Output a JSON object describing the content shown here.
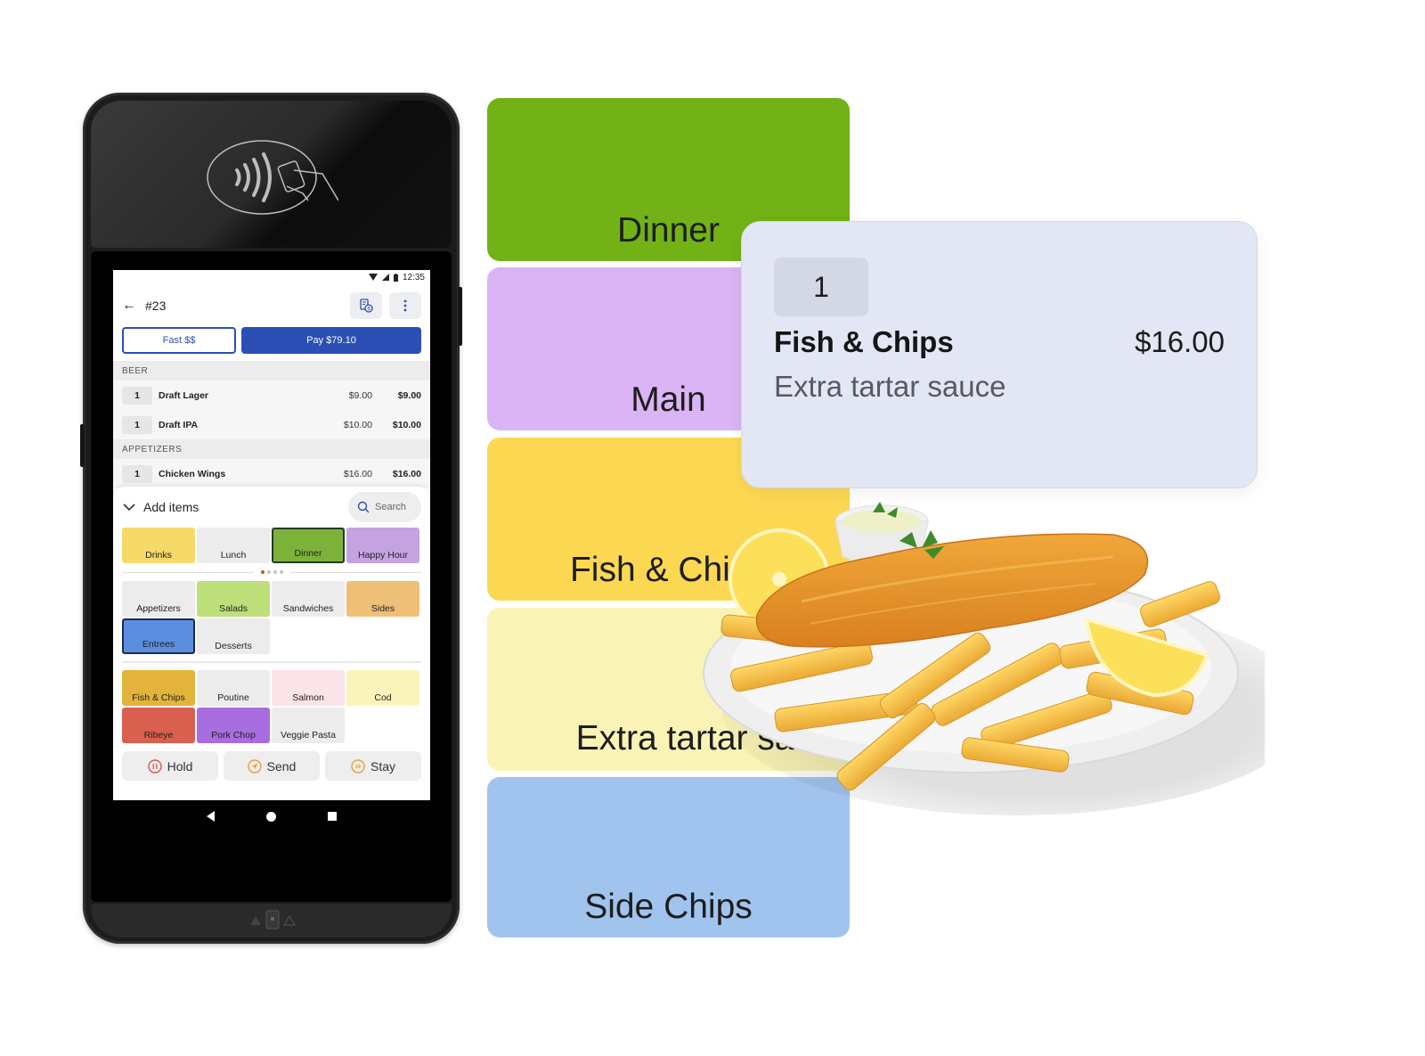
{
  "colors": {
    "accent_blue": "#2b4fb5",
    "dinner_green": "#72b216",
    "main_purple": "#dab4f4",
    "fish_yellow": "#fcd852",
    "tartar_lightyellow": "#faf3b6",
    "side_blue": "#a1c4ee",
    "detail_card_bg": "#e3e6f4"
  },
  "device": {
    "status_bar": {
      "time": "12:35"
    },
    "header": {
      "order_number": "#23",
      "back_icon": "arrow-left-icon",
      "receipt_icon": "receipt-dollar-icon",
      "more_icon": "more-vertical-icon"
    },
    "buttons": {
      "fast_label": "Fast $$",
      "pay_label": "Pay $79.10"
    },
    "order_sections": [
      {
        "title": "BEER",
        "items": [
          {
            "qty": "1",
            "name": "Draft Lager",
            "unit_price": "$9.00",
            "total": "$9.00"
          },
          {
            "qty": "1",
            "name": "Draft IPA",
            "unit_price": "$10.00",
            "total": "$10.00"
          }
        ]
      },
      {
        "title": "APPETIZERS",
        "items": [
          {
            "qty": "1",
            "name": "Chicken Wings",
            "unit_price": "$16.00",
            "total": "$16.00"
          }
        ]
      }
    ],
    "add_items": {
      "title": "Add items",
      "search_placeholder": "Search",
      "menus": [
        {
          "label": "Drinks",
          "color": "#f7d96a"
        },
        {
          "label": "Lunch",
          "color": "#ececec"
        },
        {
          "label": "Dinner",
          "color": "#7db23a",
          "selected": true
        },
        {
          "label": "Happy Hour",
          "color": "#c5a3e0"
        }
      ],
      "page_dots": {
        "count": 4,
        "active": 1
      },
      "categories": [
        {
          "label": "Appetizers",
          "color": "#ececec"
        },
        {
          "label": "Salads",
          "color": "#bde07a"
        },
        {
          "label": "Sandwiches",
          "color": "#ececec"
        },
        {
          "label": "Sides",
          "color": "#efc078"
        },
        {
          "label": "Entrees",
          "color": "#5b8ede",
          "selected": true
        },
        {
          "label": "Desserts",
          "color": "#ececec"
        }
      ],
      "items": [
        {
          "label": "Fish & Chips",
          "color": "#e3b43c"
        },
        {
          "label": "Poutine",
          "color": "#ececec"
        },
        {
          "label": "Salmon",
          "color": "#fbe4e8"
        },
        {
          "label": "Cod",
          "color": "#faf4bb"
        },
        {
          "label": "Ribeye",
          "color": "#d9604f"
        },
        {
          "label": "Pork Chop",
          "color": "#a86ddf"
        },
        {
          "label": "Veggie Pasta",
          "color": "#ececec"
        }
      ],
      "actions": [
        {
          "label": "Hold",
          "icon": "pause-circle-icon",
          "color": "#d45a4a"
        },
        {
          "label": "Send",
          "icon": "send-circle-icon",
          "color": "#e6a23a"
        },
        {
          "label": "Stay",
          "icon": "fast-forward-circle-icon",
          "color": "#e6a23a"
        }
      ]
    }
  },
  "cards": [
    {
      "label": "Dinner",
      "color": "#72b216"
    },
    {
      "label": "Main",
      "color": "#dab4f4"
    },
    {
      "label": "Fish & Chips",
      "color": "#fcd852"
    },
    {
      "label": "Extra tartar sauce",
      "color": "#faf3b6"
    },
    {
      "label": "Side Chips",
      "color": "#a1c4ee"
    }
  ],
  "detail": {
    "qty": "1",
    "name": "Fish & Chips",
    "price": "$16.00",
    "modifier": "Extra tartar sauce"
  },
  "image": {
    "subject": "fish-and-chips-plate"
  }
}
